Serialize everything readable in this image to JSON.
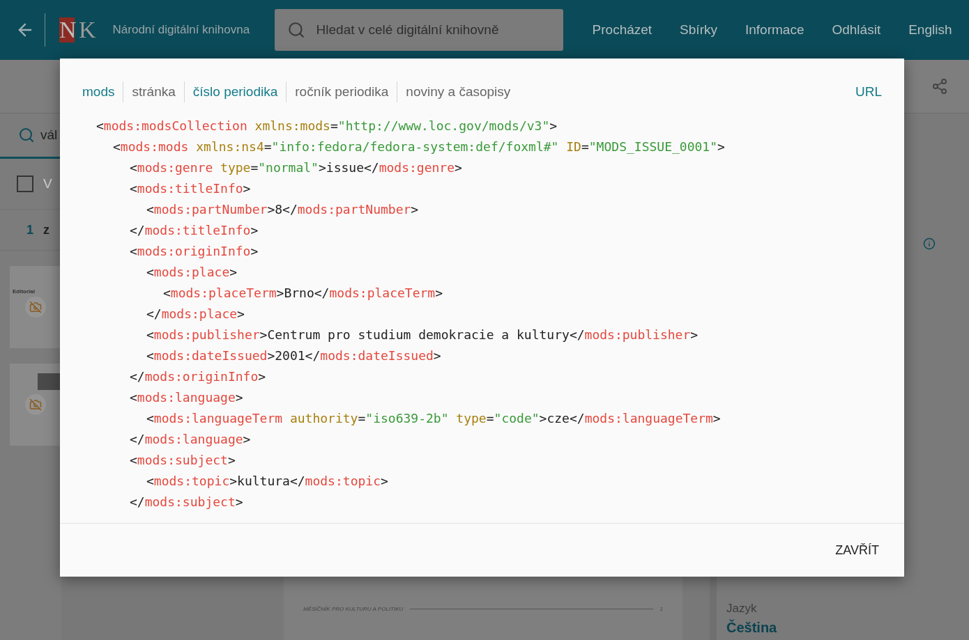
{
  "header": {
    "logo_letters": [
      "N",
      "K"
    ],
    "title": "Národní digitální knihovna",
    "search": {
      "placeholder": "Hledat v celé digitální knihovně"
    },
    "nav": [
      "Procházet",
      "Sbírky",
      "Informace",
      "Odhlásit",
      "English"
    ]
  },
  "left_panel": {
    "search_value": "vál",
    "select_all": {
      "label": "V",
      "checked": false
    },
    "pagination": [
      "1",
      "z"
    ],
    "thumbnails": [
      {
        "kind": "headed",
        "heading": "Editorial"
      },
      {
        "kind": "photo"
      }
    ]
  },
  "document": {
    "footer_text": "MĚSÍČNÍK PRO KULTURU A POLITIKU",
    "page_number": "1"
  },
  "right_panel": {
    "label": "Jazyk",
    "value": "Čeština"
  },
  "modal": {
    "tabs": [
      {
        "label": "mods",
        "highlighted": true
      },
      {
        "label": "stránka",
        "highlighted": false
      },
      {
        "label": "číslo periodika",
        "highlighted": true
      },
      {
        "label": "ročník periodika",
        "highlighted": false
      },
      {
        "label": "noviny a časopisy",
        "highlighted": false
      }
    ],
    "url_button": "URL",
    "xml": [
      {
        "open": [
          {
            "kind": "p",
            "text": "<"
          },
          {
            "kind": "tag",
            "text": "mods:modsCollection"
          },
          {
            "kind": "attr",
            "text": " xmlns:mods"
          },
          {
            "kind": "p",
            "text": "="
          },
          {
            "kind": "val",
            "text": "\"http://www.loc.gov/mods/v3\""
          },
          {
            "kind": "p",
            "text": ">"
          }
        ],
        "children": [
          {
            "open": [
              {
                "kind": "p",
                "text": "<"
              },
              {
                "kind": "tag",
                "text": "mods:mods"
              },
              {
                "kind": "attr",
                "text": " xmlns:ns4"
              },
              {
                "kind": "p",
                "text": "="
              },
              {
                "kind": "val",
                "text": "\"info:fedora/fedora-system:def/foxml#\""
              },
              {
                "kind": "attr",
                "text": " ID"
              },
              {
                "kind": "p",
                "text": "="
              },
              {
                "kind": "val",
                "text": "\"MODS_ISSUE_0001\""
              },
              {
                "kind": "p",
                "text": ">"
              }
            ],
            "children": [
              {
                "open": [
                  {
                    "kind": "p",
                    "text": "<"
                  },
                  {
                    "kind": "tag",
                    "text": "mods:genre"
                  },
                  {
                    "kind": "attr",
                    "text": " type"
                  },
                  {
                    "kind": "p",
                    "text": "="
                  },
                  {
                    "kind": "val",
                    "text": "\"normal\""
                  },
                  {
                    "kind": "p",
                    "text": ">"
                  },
                  {
                    "kind": "text",
                    "text": "issue"
                  },
                  {
                    "kind": "p",
                    "text": "</"
                  },
                  {
                    "kind": "tag",
                    "text": "mods:genre"
                  },
                  {
                    "kind": "p",
                    "text": ">"
                  }
                ]
              },
              {
                "open": [
                  {
                    "kind": "p",
                    "text": "<"
                  },
                  {
                    "kind": "tag",
                    "text": "mods:titleInfo"
                  },
                  {
                    "kind": "p",
                    "text": ">"
                  }
                ],
                "children": [
                  {
                    "open": [
                      {
                        "kind": "p",
                        "text": "<"
                      },
                      {
                        "kind": "tag",
                        "text": "mods:partNumber"
                      },
                      {
                        "kind": "p",
                        "text": ">"
                      },
                      {
                        "kind": "text",
                        "text": "8"
                      },
                      {
                        "kind": "p",
                        "text": "</"
                      },
                      {
                        "kind": "tag",
                        "text": "mods:partNumber"
                      },
                      {
                        "kind": "p",
                        "text": ">"
                      }
                    ]
                  }
                ],
                "close": [
                  {
                    "kind": "p",
                    "text": "</"
                  },
                  {
                    "kind": "tag",
                    "text": "mods:titleInfo"
                  },
                  {
                    "kind": "p",
                    "text": ">"
                  }
                ]
              },
              {
                "open": [
                  {
                    "kind": "p",
                    "text": "<"
                  },
                  {
                    "kind": "tag",
                    "text": "mods:originInfo"
                  },
                  {
                    "kind": "p",
                    "text": ">"
                  }
                ],
                "children": [
                  {
                    "open": [
                      {
                        "kind": "p",
                        "text": "<"
                      },
                      {
                        "kind": "tag",
                        "text": "mods:place"
                      },
                      {
                        "kind": "p",
                        "text": ">"
                      }
                    ],
                    "children": [
                      {
                        "open": [
                          {
                            "kind": "p",
                            "text": "<"
                          },
                          {
                            "kind": "tag",
                            "text": "mods:placeTerm"
                          },
                          {
                            "kind": "p",
                            "text": ">"
                          },
                          {
                            "kind": "text",
                            "text": "Brno"
                          },
                          {
                            "kind": "p",
                            "text": "</"
                          },
                          {
                            "kind": "tag",
                            "text": "mods:placeTerm"
                          },
                          {
                            "kind": "p",
                            "text": ">"
                          }
                        ]
                      }
                    ],
                    "close": [
                      {
                        "kind": "p",
                        "text": "</"
                      },
                      {
                        "kind": "tag",
                        "text": "mods:place"
                      },
                      {
                        "kind": "p",
                        "text": ">"
                      }
                    ]
                  },
                  {
                    "open": [
                      {
                        "kind": "p",
                        "text": "<"
                      },
                      {
                        "kind": "tag",
                        "text": "mods:publisher"
                      },
                      {
                        "kind": "p",
                        "text": ">"
                      },
                      {
                        "kind": "text",
                        "text": "Centrum pro studium demokracie a kultury"
                      },
                      {
                        "kind": "p",
                        "text": "</"
                      },
                      {
                        "kind": "tag",
                        "text": "mods:publisher"
                      },
                      {
                        "kind": "p",
                        "text": ">"
                      }
                    ]
                  },
                  {
                    "open": [
                      {
                        "kind": "p",
                        "text": "<"
                      },
                      {
                        "kind": "tag",
                        "text": "mods:dateIssued"
                      },
                      {
                        "kind": "p",
                        "text": ">"
                      },
                      {
                        "kind": "text",
                        "text": "2001"
                      },
                      {
                        "kind": "p",
                        "text": "</"
                      },
                      {
                        "kind": "tag",
                        "text": "mods:dateIssued"
                      },
                      {
                        "kind": "p",
                        "text": ">"
                      }
                    ]
                  }
                ],
                "close": [
                  {
                    "kind": "p",
                    "text": "</"
                  },
                  {
                    "kind": "tag",
                    "text": "mods:originInfo"
                  },
                  {
                    "kind": "p",
                    "text": ">"
                  }
                ]
              },
              {
                "open": [
                  {
                    "kind": "p",
                    "text": "<"
                  },
                  {
                    "kind": "tag",
                    "text": "mods:language"
                  },
                  {
                    "kind": "p",
                    "text": ">"
                  }
                ],
                "children": [
                  {
                    "open": [
                      {
                        "kind": "p",
                        "text": "<"
                      },
                      {
                        "kind": "tag",
                        "text": "mods:languageTerm"
                      },
                      {
                        "kind": "attr",
                        "text": " authority"
                      },
                      {
                        "kind": "p",
                        "text": "="
                      },
                      {
                        "kind": "val",
                        "text": "\"iso639-2b\""
                      },
                      {
                        "kind": "attr",
                        "text": " type"
                      },
                      {
                        "kind": "p",
                        "text": "="
                      },
                      {
                        "kind": "val",
                        "text": "\"code\""
                      },
                      {
                        "kind": "p",
                        "text": ">"
                      },
                      {
                        "kind": "text",
                        "text": "cze"
                      },
                      {
                        "kind": "p",
                        "text": "</"
                      },
                      {
                        "kind": "tag",
                        "text": "mods:languageTerm"
                      },
                      {
                        "kind": "p",
                        "text": ">"
                      }
                    ]
                  }
                ],
                "close": [
                  {
                    "kind": "p",
                    "text": "</"
                  },
                  {
                    "kind": "tag",
                    "text": "mods:language"
                  },
                  {
                    "kind": "p",
                    "text": ">"
                  }
                ]
              },
              {
                "open": [
                  {
                    "kind": "p",
                    "text": "<"
                  },
                  {
                    "kind": "tag",
                    "text": "mods:subject"
                  },
                  {
                    "kind": "p",
                    "text": ">"
                  }
                ],
                "children": [
                  {
                    "open": [
                      {
                        "kind": "p",
                        "text": "<"
                      },
                      {
                        "kind": "tag",
                        "text": "mods:topic"
                      },
                      {
                        "kind": "p",
                        "text": ">"
                      },
                      {
                        "kind": "text",
                        "text": "kultura"
                      },
                      {
                        "kind": "p",
                        "text": "</"
                      },
                      {
                        "kind": "tag",
                        "text": "mods:topic"
                      },
                      {
                        "kind": "p",
                        "text": ">"
                      }
                    ]
                  }
                ],
                "close": [
                  {
                    "kind": "p",
                    "text": "</"
                  },
                  {
                    "kind": "tag",
                    "text": "mods:subject"
                  },
                  {
                    "kind": "p",
                    "text": ">"
                  }
                ]
              }
            ]
          }
        ]
      }
    ],
    "close_button": "ZAVŘÍT"
  }
}
